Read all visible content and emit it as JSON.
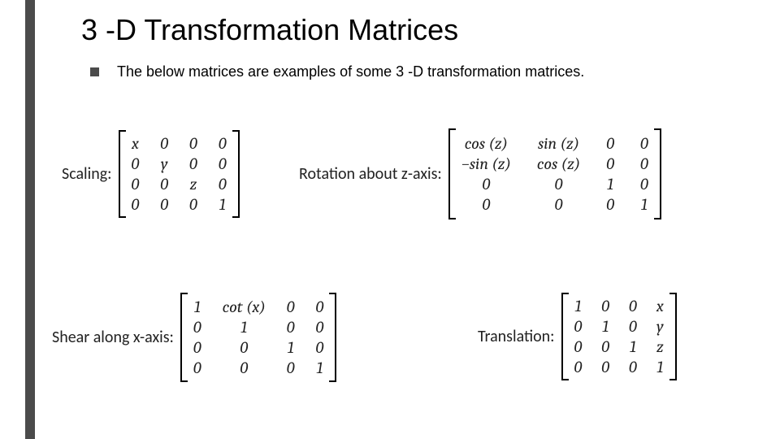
{
  "title": "3 -D Transformation Matrices",
  "bullet": "The below matrices are examples of some 3 -D transformation matrices.",
  "blocks": {
    "scaling": {
      "label": "Scaling:",
      "rows": [
        [
          "x",
          "0",
          "0",
          "0"
        ],
        [
          "0",
          "y",
          "0",
          "0"
        ],
        [
          "0",
          "0",
          "z",
          "0"
        ],
        [
          "0",
          "0",
          "0",
          "1"
        ]
      ]
    },
    "rotation": {
      "label": "Rotation about z-axis:",
      "rows": [
        [
          "cos (z)",
          "sin (z)",
          "0",
          "0"
        ],
        [
          "−sin (z)",
          "cos (z)",
          "0",
          "0"
        ],
        [
          "0",
          "0",
          "1",
          "0"
        ],
        [
          "0",
          "0",
          "0",
          "1"
        ]
      ]
    },
    "shear": {
      "label": "Shear along x-axis:",
      "rows": [
        [
          "1",
          "cot (x)",
          "0",
          "0"
        ],
        [
          "0",
          "1",
          "0",
          "0"
        ],
        [
          "0",
          "0",
          "1",
          "0"
        ],
        [
          "0",
          "0",
          "0",
          "1"
        ]
      ]
    },
    "translation": {
      "label": "Translation:",
      "rows": [
        [
          "1",
          "0",
          "0",
          "x"
        ],
        [
          "0",
          "1",
          "0",
          "y"
        ],
        [
          "0",
          "0",
          "1",
          "z"
        ],
        [
          "0",
          "0",
          "0",
          "1"
        ]
      ]
    }
  }
}
